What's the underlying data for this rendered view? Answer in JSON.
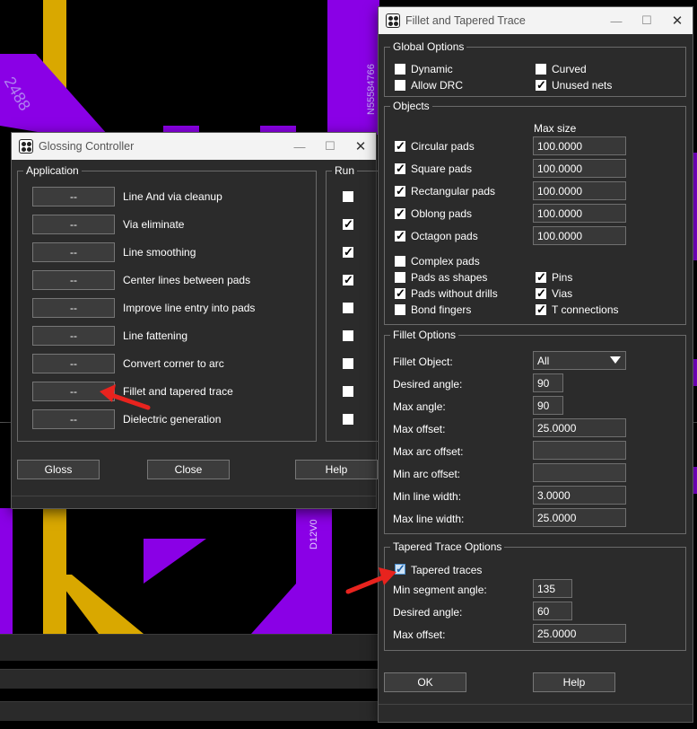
{
  "background": {
    "net_label_1": "N55584766",
    "net_label_2": "D12V0",
    "net_label_3": "2488"
  },
  "gloss": {
    "title": "Glossing Controller",
    "application_label": "Application",
    "run_label": "Run",
    "rows": [
      {
        "button": "--",
        "label": "Line And via cleanup",
        "run": false
      },
      {
        "button": "--",
        "label": "Via eliminate",
        "run": true
      },
      {
        "button": "--",
        "label": "Line smoothing",
        "run": true
      },
      {
        "button": "--",
        "label": "Center lines between pads",
        "run": true
      },
      {
        "button": "--",
        "label": "Improve line entry into pads",
        "run": false
      },
      {
        "button": "--",
        "label": "Line fattening",
        "run": false
      },
      {
        "button": "--",
        "label": "Convert corner to arc",
        "run": false
      },
      {
        "button": "--",
        "label": "Fillet and tapered trace",
        "run": false
      },
      {
        "button": "--",
        "label": "Dielectric generation",
        "run": false
      }
    ],
    "gloss_button": "Gloss",
    "close_button": "Close",
    "help_button": "Help"
  },
  "fillet": {
    "title": "Fillet and Tapered Trace",
    "global_options": {
      "label": "Global Options",
      "dynamic": "Dynamic",
      "curved": "Curved",
      "allow_drc": "Allow DRC",
      "unused_nets": "Unused nets"
    },
    "objects": {
      "label": "Objects",
      "max_size_label": "Max size",
      "pads": [
        {
          "label": "Circular pads",
          "value": "100.0000"
        },
        {
          "label": "Square pads",
          "value": "100.0000"
        },
        {
          "label": "Rectangular pads",
          "value": "100.0000"
        },
        {
          "label": "Oblong pads",
          "value": "100.0000"
        },
        {
          "label": "Octagon pads",
          "value": "100.0000"
        }
      ],
      "complex_pads": "Complex pads",
      "pads_as_shapes": "Pads as shapes",
      "pins": "Pins",
      "pads_without_drills": "Pads without drills",
      "vias": "Vias",
      "bond_fingers": "Bond fingers",
      "t_connections": "T connections"
    },
    "fillet_options": {
      "label": "Fillet Options",
      "fillet_object_label": "Fillet Object:",
      "fillet_object_value": "All",
      "desired_angle_label": "Desired angle:",
      "desired_angle_value": "90",
      "max_angle_label": "Max angle:",
      "max_angle_value": "90",
      "max_offset_label": "Max offset:",
      "max_offset_value": "25.0000",
      "max_arc_offset_label": "Max arc offset:",
      "min_arc_offset_label": "Min arc offset:",
      "min_line_width_label": "Min line width:",
      "min_line_width_value": "3.0000",
      "max_line_width_label": "Max line width:",
      "max_line_width_value": "25.0000"
    },
    "tapered": {
      "label": "Tapered Trace Options",
      "tapered_traces": "Tapered traces",
      "min_segment_angle_label": "Min segment angle:",
      "min_segment_angle_value": "135",
      "desired_angle_label": "Desired angle:",
      "desired_angle_value": "60",
      "max_offset_label": "Max offset:",
      "max_offset_value": "25.0000"
    },
    "ok_button": "OK",
    "help_button": "Help"
  },
  "colors": {
    "trace_yellow": "#d9a800",
    "trace_purple": "#8a00e6",
    "annotation_arrow": "#e8231e"
  }
}
